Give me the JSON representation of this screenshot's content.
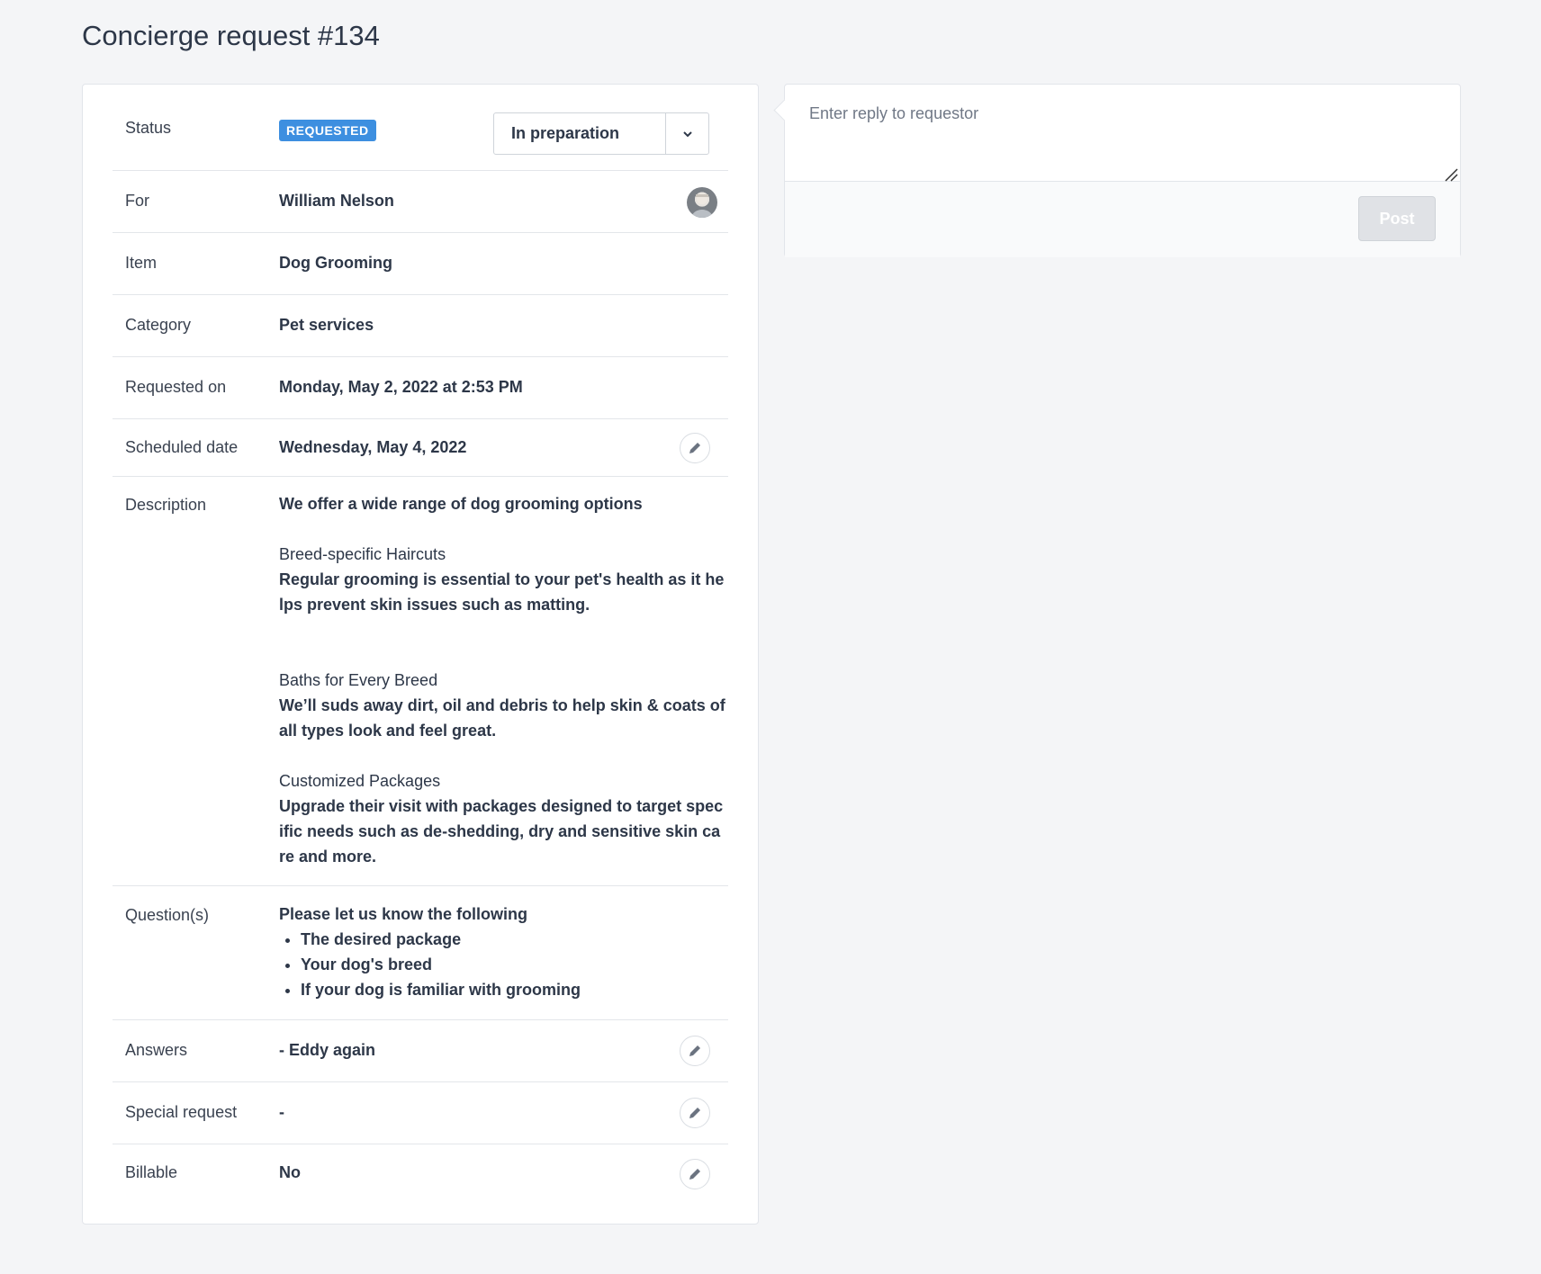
{
  "page": {
    "title": "Concierge request #134"
  },
  "details": {
    "status": {
      "label": "Status",
      "badge": "REQUESTED",
      "select_value": "In preparation"
    },
    "for": {
      "label": "For",
      "name": "William Nelson"
    },
    "item": {
      "label": "Item",
      "value": "Dog Grooming"
    },
    "category": {
      "label": "Category",
      "value": "Pet services"
    },
    "requested_on": {
      "label": "Requested on",
      "value": "Monday, May 2, 2022 at 2:53 PM"
    },
    "scheduled_date": {
      "label": "Scheduled date",
      "value": "Wednesday, May 4, 2022"
    },
    "description": {
      "label": "Description",
      "intro": "We offer a wide range of dog grooming options",
      "sections": [
        {
          "heading": "Breed-specific Haircuts",
          "text": "Regular grooming is essential to your pet's health as it helps prevent skin issues such as matting."
        },
        {
          "heading": "Baths for Every Breed",
          "text": "We’ll suds away dirt, oil and debris to help skin & coats of all types look and feel great."
        },
        {
          "heading": "Customized Packages",
          "text": "Upgrade their visit with packages designed to target specific needs such as de-shedding, dry and sensitive skin care and more."
        }
      ]
    },
    "questions": {
      "label": "Question(s)",
      "intro": "Please let us know the following",
      "items": [
        "The desired package",
        "Your dog's breed",
        "If your dog is familiar with grooming"
      ]
    },
    "answers": {
      "label": "Answers",
      "value": "- Eddy again"
    },
    "special_request": {
      "label": "Special request",
      "value": "-"
    },
    "billable": {
      "label": "Billable",
      "value": "No"
    }
  },
  "reply": {
    "placeholder": "Enter reply to requestor",
    "post_label": "Post"
  },
  "colors": {
    "badge": "#3d8fe0",
    "link": "#3d8fe0",
    "background": "#f4f5f7"
  }
}
